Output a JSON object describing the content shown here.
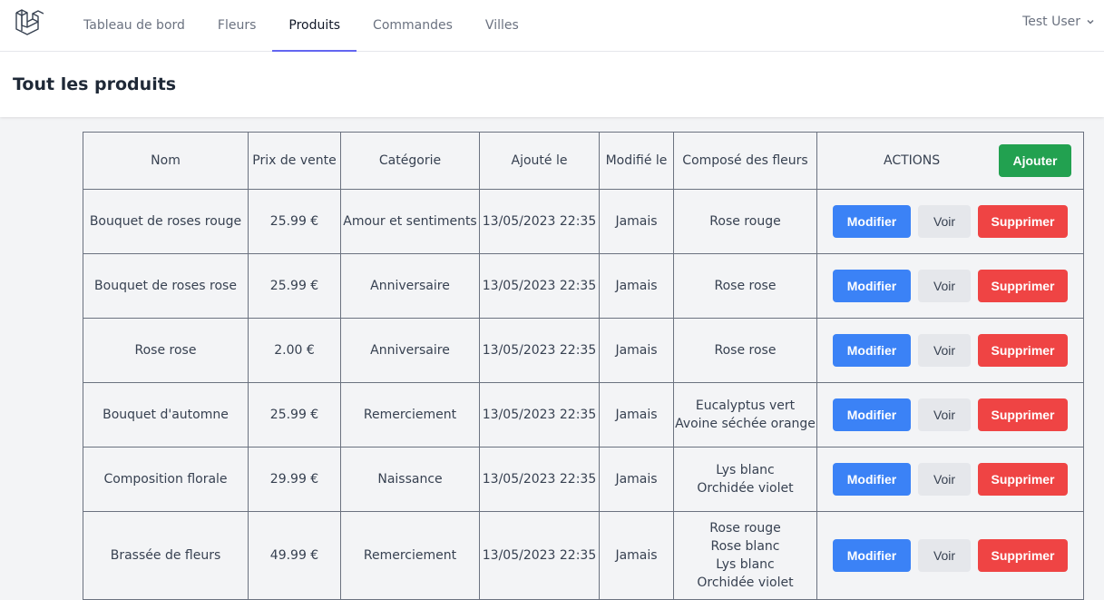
{
  "nav": {
    "links": [
      "Tableau de bord",
      "Fleurs",
      "Produits",
      "Commandes",
      "Villes"
    ],
    "active_index": 2,
    "user": "Test User"
  },
  "header": {
    "title": "Tout les produits"
  },
  "table": {
    "columns": [
      "Nom",
      "Prix de vente",
      "Catégorie",
      "Ajouté le",
      "Modifié le",
      "Composé des fleurs",
      "ACTIONS"
    ],
    "add_label": "Ajouter",
    "actions": {
      "edit": "Modifier",
      "view": "Voir",
      "delete": "Supprimer"
    },
    "rows": [
      {
        "nom": "Bouquet de roses rouge",
        "prix": "25.99 €",
        "categorie": "Amour et sentiments",
        "ajoute": "13/05/2023 22:35",
        "modifie": "Jamais",
        "fleurs": [
          "Rose rouge"
        ]
      },
      {
        "nom": "Bouquet de roses rose",
        "prix": "25.99 €",
        "categorie": "Anniversaire",
        "ajoute": "13/05/2023 22:35",
        "modifie": "Jamais",
        "fleurs": [
          "Rose rose"
        ]
      },
      {
        "nom": "Rose rose",
        "prix": "2.00 €",
        "categorie": "Anniversaire",
        "ajoute": "13/05/2023 22:35",
        "modifie": "Jamais",
        "fleurs": [
          "Rose rose"
        ]
      },
      {
        "nom": "Bouquet d'automne",
        "prix": "25.99 €",
        "categorie": "Remerciement",
        "ajoute": "13/05/2023 22:35",
        "modifie": "Jamais",
        "fleurs": [
          "Eucalyptus vert",
          "Avoine séchée orange"
        ]
      },
      {
        "nom": "Composition florale",
        "prix": "29.99 €",
        "categorie": "Naissance",
        "ajoute": "13/05/2023 22:35",
        "modifie": "Jamais",
        "fleurs": [
          "Lys blanc",
          "Orchidée violet"
        ]
      },
      {
        "nom": "Brassée de fleurs",
        "prix": "49.99 €",
        "categorie": "Remerciement",
        "ajoute": "13/05/2023 22:35",
        "modifie": "Jamais",
        "fleurs": [
          "Rose rouge",
          "Rose blanc",
          "Lys blanc",
          "Orchidée violet"
        ]
      }
    ]
  }
}
